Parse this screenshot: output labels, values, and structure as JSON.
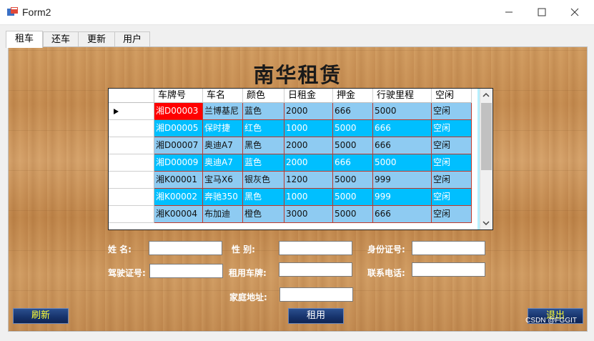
{
  "window": {
    "title": "Form2"
  },
  "tabs": [
    "租车",
    "还车",
    "更新",
    "用户"
  ],
  "heading": "南华租赁",
  "table": {
    "columns": [
      "车牌号",
      "车名",
      "颜色",
      "日租金",
      "押金",
      "行驶里程",
      "空闲"
    ],
    "rows": [
      [
        "湘D00003",
        "兰博基尼",
        "蓝色",
        "2000",
        "666",
        "5000",
        "空闲"
      ],
      [
        "湘D00005",
        "保时捷",
        "红色",
        "1000",
        "5000",
        "666",
        "空闲"
      ],
      [
        "湘D00007",
        "奥迪A7",
        "黑色",
        "2000",
        "5000",
        "666",
        "空闲"
      ],
      [
        "湘D00009",
        "奥迪A7",
        "蓝色",
        "2000",
        "666",
        "5000",
        "空闲"
      ],
      [
        "湘K00001",
        "宝马X6",
        "银灰色",
        "1200",
        "5000",
        "999",
        "空闲"
      ],
      [
        "湘K00002",
        "奔驰350",
        "黑色",
        "1000",
        "5000",
        "999",
        "空闲"
      ],
      [
        "湘K00004",
        "布加迪",
        "橙色",
        "3000",
        "5000",
        "666",
        "空闲"
      ]
    ]
  },
  "form": {
    "name_label": "姓    名:",
    "gender_label": "性    别:",
    "id_label": "身份证号:",
    "license_label": "驾驶证号:",
    "plate_label": "租用车牌:",
    "phone_label": "联系电话:",
    "address_label": "家庭地址:"
  },
  "buttons": {
    "refresh": "刷新",
    "rent": "租用",
    "exit": "退出"
  },
  "watermark": "CSDN @FGGIT",
  "colors": {
    "row_odd": "#8ecbf2",
    "row_even": "#00bfff",
    "selected_cell": "#ff0000"
  }
}
